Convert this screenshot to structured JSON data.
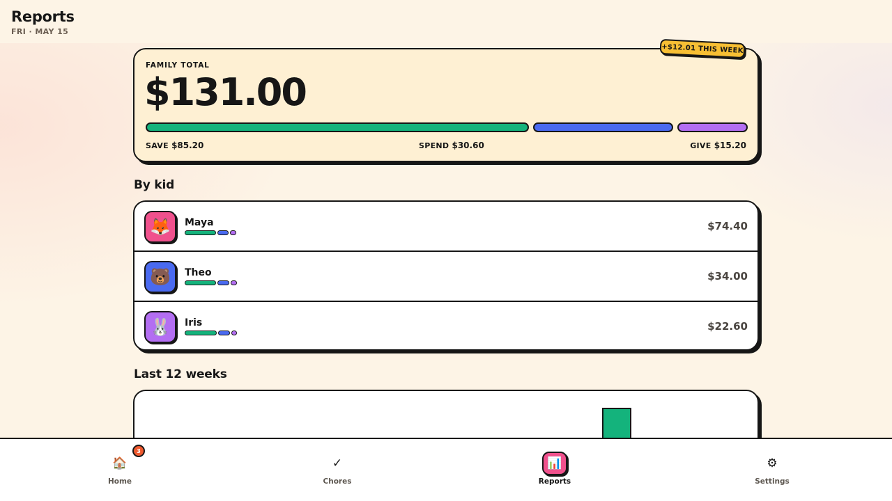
{
  "header": {
    "title": "Reports",
    "date": "FRI · MAY 15"
  },
  "family_total": {
    "label": "FAMILY TOTAL",
    "amount": "$131.00",
    "week_badge": "+$12.01 THIS WEEK",
    "split": [
      {
        "key": "save",
        "label": "SAVE",
        "amount": "$85.20",
        "value": 85.2,
        "color": "#14b37c"
      },
      {
        "key": "spend",
        "label": "SPEND",
        "amount": "$30.60",
        "value": 30.6,
        "color": "#4a6af0"
      },
      {
        "key": "give",
        "label": "GIVE",
        "amount": "$15.20",
        "value": 15.2,
        "color": "#b36ef2"
      }
    ]
  },
  "by_kid": {
    "title": "By kid",
    "kids": [
      {
        "name": "Maya",
        "balance": "$74.40",
        "avatar_icon": "fox-icon",
        "avatar_glyph": "🦊",
        "avatar_color": "#f0518d"
      },
      {
        "name": "Theo",
        "balance": "$34.00",
        "avatar_icon": "bear-icon",
        "avatar_glyph": "🐻",
        "avatar_color": "#4a6af0"
      },
      {
        "name": "Iris",
        "balance": "$22.60",
        "avatar_icon": "rabbit-icon",
        "avatar_glyph": "🐰",
        "avatar_color": "#b36ef2"
      }
    ]
  },
  "weeks_chart": {
    "title": "Last 12 weeks"
  },
  "chart_data": {
    "type": "bar",
    "title": "Last 12 weeks",
    "series_color": "#14b37c"
  },
  "nav": {
    "items": [
      {
        "key": "home",
        "label": "Home",
        "icon": "home-icon",
        "glyph": "🏠",
        "badge": "3",
        "active": false
      },
      {
        "key": "chores",
        "label": "Chores",
        "icon": "check-icon",
        "glyph": "✓",
        "active": false
      },
      {
        "key": "reports",
        "label": "Reports",
        "icon": "bar-chart-icon",
        "glyph": "📊",
        "active": true
      },
      {
        "key": "settings",
        "label": "Settings",
        "icon": "gear-icon",
        "glyph": "⚙",
        "active": false
      }
    ]
  }
}
